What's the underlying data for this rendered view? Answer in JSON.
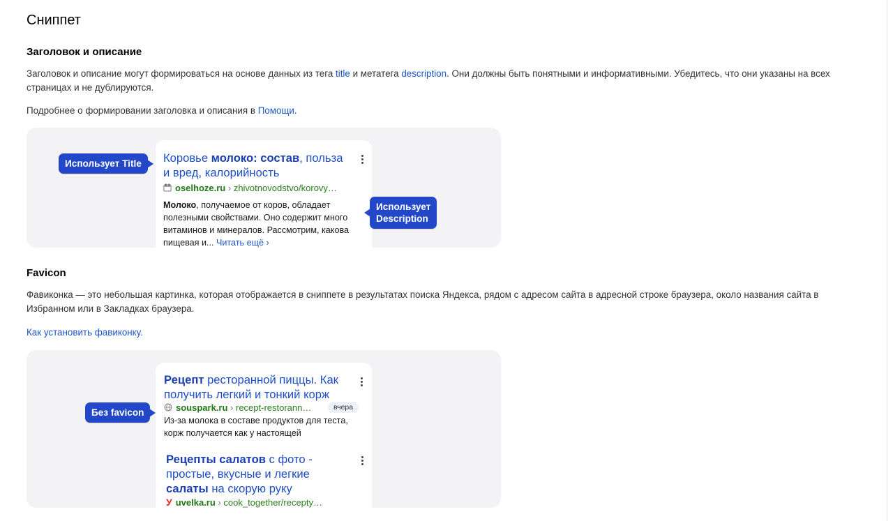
{
  "page": {
    "title": "Сниппет"
  },
  "section1": {
    "heading": "Заголовок и описание",
    "para1_a": "Заголовок и описание могут формироваться на основе данных из тега ",
    "para1_link1": "title",
    "para1_b": " и метатега ",
    "para1_link2": "description",
    "para1_c": ". Они должны быть понятными и информативными. Убедитесь, что они указаны на всех страницах и не дублируются.",
    "para2_a": "Подробнее о формировании заголовка и описания в ",
    "para2_link": "Помощи",
    "para2_b": ".",
    "demo": {
      "callout_title": "Использует Title",
      "callout_desc_line1": "Использует",
      "callout_desc_line2": "Description",
      "snippet": {
        "title_1": "Коровье ",
        "title_b1": "молоко",
        "title_2": ": ",
        "title_b2": "состав",
        "title_3": ", польза",
        "title_line2": "и вред, калорийность",
        "domain": "oselhoze.ru",
        "path": "zhivotnovodstvo/korovy…",
        "desc_b": "Молоко",
        "desc_1": ", получаемое от коров, обладает",
        "desc_2": "полезными свойствами. Оно содержит много",
        "desc_3": "витаминов и минералов. Рассмотрим, какова",
        "desc_4": "пищевая и... ",
        "read_more": "Читать ещё ›"
      }
    }
  },
  "section2": {
    "heading": "Favicon",
    "para1": "Фавиконка — это небольшая картинка, которая отображается в сниппете в результатах поиска Яндекса, рядом с адресом сайта в адресной строке браузера, около названия сайта в Избранном или в Закладках браузера.",
    "link": "Как установить фавиконку.",
    "demo": {
      "callout_nofav": "Без favicon",
      "snippet1": {
        "title_b1": "Рецепт",
        "title_1": " ресторанной пиццы. Как",
        "title_line2": "получить легкий и тонкий корж",
        "domain": "souspark.ru",
        "path": "recept-restorann…",
        "badge": "вчера",
        "desc_1": "Из-за молока в составе продуктов для теста,",
        "desc_2": "корж получается как у настоящей"
      },
      "snippet2": {
        "title_b1": "Рецепты салатов",
        "title_1": " с фото -",
        "title_line2": "простые, вкусные и легкие",
        "title_b2": "салаты",
        "title_3": " на скорую руку",
        "fav_letter": "У",
        "domain": "uvelka.ru",
        "path": "cook_together/recepty…"
      }
    }
  },
  "colors": {
    "link": "#1e56c8",
    "callout": "#2248c9",
    "url_green": "#1f7a16",
    "demo_bg": "#f3f3f5"
  }
}
